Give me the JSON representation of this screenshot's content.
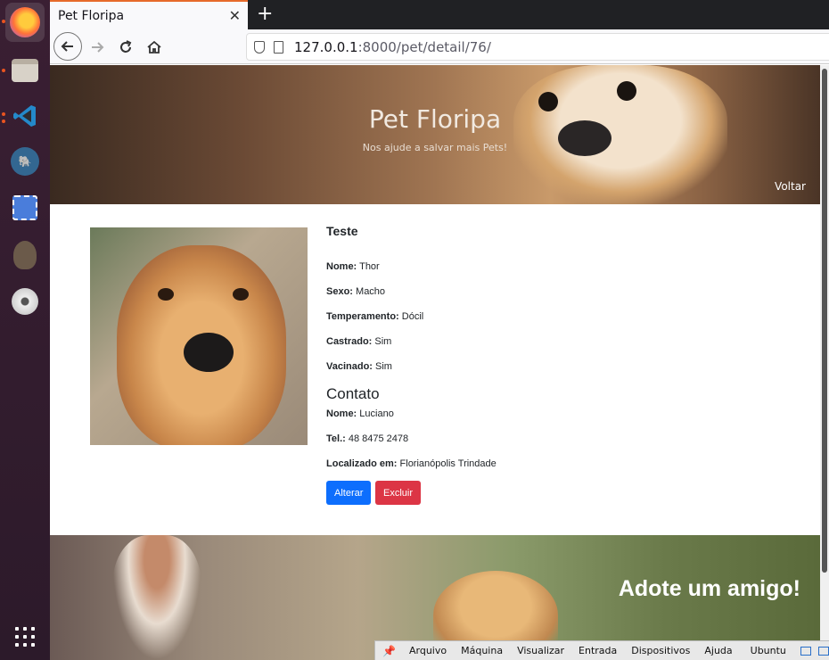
{
  "browser": {
    "tab_title": "Pet Floripa",
    "tab_close": "✕",
    "new_tab": "+",
    "url_host": "127.0.0.1",
    "url_rest": ":8000/pet/detail/76/"
  },
  "hero": {
    "title": "Pet Floripa",
    "subtitle": "Nos ajude a salvar mais Pets!",
    "back_link": "Voltar"
  },
  "pet": {
    "name": "Teste",
    "fields": [
      {
        "label": "Nome:",
        "value": "Thor"
      },
      {
        "label": "Sexo:",
        "value": "Macho"
      },
      {
        "label": "Temperamento:",
        "value": "Dócil"
      },
      {
        "label": "Castrado:",
        "value": "Sim"
      },
      {
        "label": "Vacinado:",
        "value": "Sim"
      }
    ]
  },
  "contact": {
    "heading": "Contato",
    "fields": [
      {
        "label": "Nome:",
        "value": "Luciano"
      },
      {
        "label": "Tel.:",
        "value": "48 8475 2478"
      },
      {
        "label": "Localizado em:",
        "value": "Florianópolis Trindade"
      }
    ]
  },
  "actions": {
    "edit_label": "Alterar",
    "delete_label": "Excluir",
    "edit_color": "#0d6efd",
    "delete_color": "#dc3545"
  },
  "banner": {
    "text": "Adote um amigo!"
  },
  "vbox_menu": {
    "items": [
      "Arquivo",
      "Máquina",
      "Visualizar",
      "Entrada",
      "Dispositivos",
      "Ajuda"
    ],
    "vm_name": "Ubuntu"
  },
  "dock": {
    "apps": [
      "firefox-icon",
      "files-icon",
      "vscode-icon",
      "postgresql-icon",
      "screenshot-icon",
      "gimp-icon",
      "disc-icon",
      "show-apps-icon"
    ]
  }
}
